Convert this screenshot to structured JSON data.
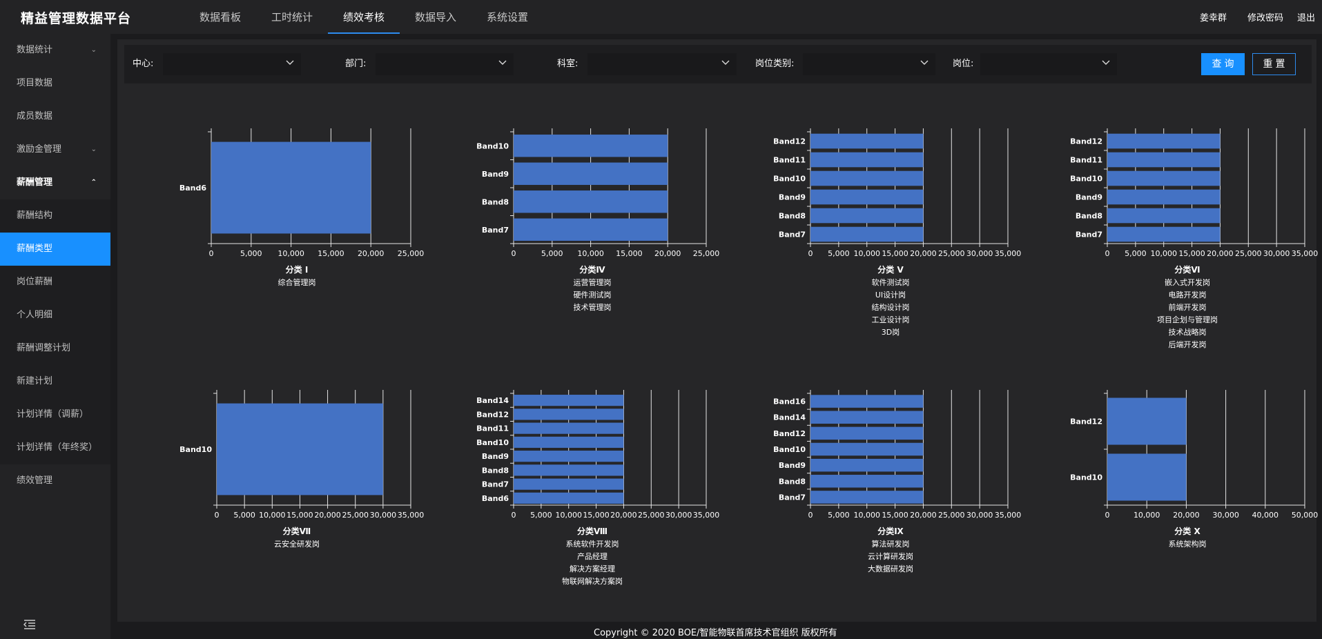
{
  "app": {
    "title": "精益管理数据平台",
    "footer": "Copyright © 2020 BOE/智能物联首席技术官组织 版权所有"
  },
  "nav": {
    "tabs": [
      {
        "label": "数据看板",
        "active": false
      },
      {
        "label": "工时统计",
        "active": false
      },
      {
        "label": "绩效考核",
        "active": true
      },
      {
        "label": "数据导入",
        "active": false
      },
      {
        "label": "系统设置",
        "active": false
      }
    ]
  },
  "user": {
    "name": "姜幸群",
    "change_password": "修改密码",
    "logout": "退出"
  },
  "sidebar": {
    "items": [
      {
        "label": "数据统计",
        "type": "group",
        "expanded": false
      },
      {
        "label": "项目数据",
        "type": "item"
      },
      {
        "label": "成员数据",
        "type": "item"
      },
      {
        "label": "激励金管理",
        "type": "group",
        "expanded": false
      },
      {
        "label": "薪酬管理",
        "type": "group",
        "expanded": true
      },
      {
        "label": "薪酬结构",
        "type": "sub"
      },
      {
        "label": "薪酬类型",
        "type": "sub",
        "active": true
      },
      {
        "label": "岗位薪酬",
        "type": "sub"
      },
      {
        "label": "个人明细",
        "type": "sub"
      },
      {
        "label": "薪酬调整计划",
        "type": "sub"
      },
      {
        "label": "新建计划",
        "type": "sub"
      },
      {
        "label": "计划详情（调薪）",
        "type": "sub"
      },
      {
        "label": "计划详情（年终奖）",
        "type": "sub"
      },
      {
        "label": "绩效管理",
        "type": "item"
      }
    ]
  },
  "filters": {
    "center_label": "中心:",
    "dept_label": "部门:",
    "section_label": "科室:",
    "job_category_label": "岗位类别:",
    "job_label": "岗位:",
    "query_button": "查询",
    "reset_button": "重置"
  },
  "colors": {
    "bar": "#4472c4",
    "accent": "#1890ff",
    "background": "#262628"
  },
  "chart_data": [
    {
      "type": "bar",
      "title": "分类 Ⅰ",
      "jobs": [
        "综合管理岗"
      ],
      "categories": [
        "Band6"
      ],
      "values": [
        20000
      ],
      "xlim": [
        0,
        25000
      ],
      "xticks": [
        "0",
        "5,000",
        "10,000",
        "15,000",
        "20,000",
        "25,000"
      ],
      "grid": true
    },
    {
      "type": "bar",
      "title": "分类Ⅳ",
      "jobs": [
        "运营管理岗",
        "硬件测试岗",
        "技术管理岗"
      ],
      "categories": [
        "Band10",
        "Band9",
        "Band8",
        "Band7"
      ],
      "values": [
        20000,
        20000,
        20000,
        20000
      ],
      "xlim": [
        0,
        25000
      ],
      "xticks": [
        "0",
        "5,000",
        "10,000",
        "15,000",
        "20,000",
        "25,000"
      ],
      "grid": true
    },
    {
      "type": "bar",
      "title": "分类 Ⅴ",
      "jobs": [
        "软件测试岗",
        "UI设计岗",
        "结构设计岗",
        "工业设计岗",
        "3D岗"
      ],
      "categories": [
        "Band12",
        "Band11",
        "Band10",
        "Band9",
        "Band8",
        "Band7"
      ],
      "values": [
        20000,
        20000,
        20000,
        20000,
        20000,
        20000
      ],
      "xlim": [
        0,
        35000
      ],
      "xticks": [
        "0",
        "5,000",
        "10,000",
        "15,000",
        "20,000",
        "25,000",
        "30,000",
        "35,000"
      ],
      "grid": true
    },
    {
      "type": "bar",
      "title": "分类Ⅵ",
      "jobs": [
        "嵌入式开发岗",
        "电路开发岗",
        "前端开发岗",
        "项目企划与管理岗",
        "技术战略岗",
        "后端开发岗"
      ],
      "categories": [
        "Band12",
        "Band11",
        "Band10",
        "Band9",
        "Band8",
        "Band7"
      ],
      "values": [
        20000,
        20000,
        20000,
        20000,
        20000,
        20000
      ],
      "xlim": [
        0,
        35000
      ],
      "xticks": [
        "0",
        "5,000",
        "10,000",
        "15,000",
        "20,000",
        "25,000",
        "30,000",
        "35,000"
      ],
      "grid": true
    },
    {
      "type": "bar",
      "title": "分类Ⅶ",
      "jobs": [
        "云安全研发岗"
      ],
      "categories": [
        "Band10"
      ],
      "values": [
        30000
      ],
      "xlim": [
        0,
        35000
      ],
      "xticks": [
        "0",
        "5,000",
        "10,000",
        "15,000",
        "20,000",
        "25,000",
        "30,000",
        "35,000"
      ],
      "grid": true
    },
    {
      "type": "bar",
      "title": "分类Ⅷ",
      "jobs": [
        "系统软件开发岗",
        "产品经理",
        "解决方案经理",
        "物联网解决方案岗"
      ],
      "categories": [
        "Band14",
        "Band12",
        "Band11",
        "Band10",
        "Band9",
        "Band8",
        "Band7",
        "Band6"
      ],
      "values": [
        20000,
        20000,
        20000,
        20000,
        20000,
        20000,
        20000,
        20000
      ],
      "xlim": [
        0,
        35000
      ],
      "xticks": [
        "0",
        "5,000",
        "10,000",
        "15,000",
        "20,000",
        "25,000",
        "30,000",
        "35,000"
      ],
      "grid": true
    },
    {
      "type": "bar",
      "title": "分类Ⅸ",
      "jobs": [
        "算法研发岗",
        "云计算研发岗",
        "大数据研发岗"
      ],
      "categories": [
        "Band16",
        "Band14",
        "Band12",
        "Band10",
        "Band9",
        "Band8",
        "Band7"
      ],
      "values": [
        20000,
        20000,
        20000,
        20000,
        20000,
        20000,
        20000
      ],
      "xlim": [
        0,
        35000
      ],
      "xticks": [
        "0",
        "5,000",
        "10,000",
        "15,000",
        "20,000",
        "25,000",
        "30,000",
        "35,000"
      ],
      "grid": true
    },
    {
      "type": "bar",
      "title": "分类 Ⅹ",
      "jobs": [
        "系统架构岗"
      ],
      "categories": [
        "Band12",
        "Band10"
      ],
      "values": [
        20000,
        20000
      ],
      "xlim": [
        0,
        50000
      ],
      "xticks": [
        "0",
        "10,000",
        "20,000",
        "30,000",
        "40,000",
        "50,000"
      ],
      "grid": true
    }
  ]
}
